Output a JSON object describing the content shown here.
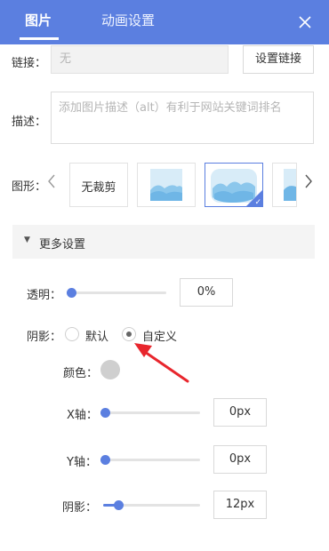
{
  "header": {
    "tabs": [
      {
        "label": "图片"
      },
      {
        "label": "动画设置"
      }
    ],
    "close_icon": "close-icon",
    "accent": "#5b7fe0"
  },
  "link": {
    "label": "链接：",
    "value": "无",
    "button_label": "设置链接"
  },
  "description": {
    "label": "描述：",
    "placeholder": "添加图片描述（alt）有利于网站关键词排名"
  },
  "shape": {
    "label": "图形：",
    "options": [
      {
        "label": "无裁剪"
      },
      {
        "label": ""
      },
      {
        "label": ""
      },
      {
        "label": ""
      }
    ],
    "selected_index": 2
  },
  "more": {
    "label": "更多设置"
  },
  "opacity": {
    "label": "透明：",
    "value": "0%",
    "level": 0
  },
  "shadow": {
    "label": "阴影：",
    "options": [
      {
        "label": "默认"
      },
      {
        "label": "自定义"
      }
    ],
    "selected": "自定义",
    "color_label": "颜色：",
    "color": "#cfcfcf",
    "x": {
      "label": "X轴：",
      "value": "0px",
      "level": 0
    },
    "y": {
      "label": "Y轴：",
      "value": "0px",
      "level": 0
    },
    "blur": {
      "label": "阴影：",
      "value": "12px",
      "level": 0.12
    }
  }
}
